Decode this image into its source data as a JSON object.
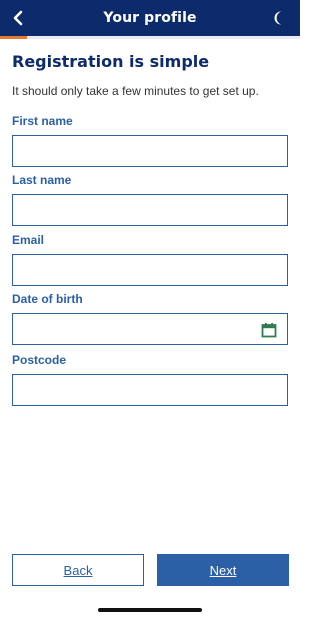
{
  "header": {
    "title": "Your profile",
    "back_icon": "chevron-left-icon",
    "theme_icon": "crescent-moon-icon",
    "progress_fraction": 0.09,
    "progress_color": "#e57b2d",
    "bar_color": "#0d2a6b"
  },
  "main": {
    "heading": "Registration is simple",
    "intro": "It should only take a few minutes to get set up."
  },
  "form": {
    "first_name": {
      "label": "First name",
      "value": ""
    },
    "last_name": {
      "label": "Last name",
      "value": ""
    },
    "email": {
      "label": "Email",
      "value": ""
    },
    "dob": {
      "label": "Date of birth",
      "value": "",
      "icon": "calendar-icon"
    },
    "postcode": {
      "label": "Postcode",
      "value": ""
    }
  },
  "buttons": {
    "back_label": "Back",
    "next_label": "Next"
  },
  "colors": {
    "accent": "#2b5fa6",
    "heading": "#0d2a6b",
    "calendar_icon": "#2e7d4f"
  }
}
